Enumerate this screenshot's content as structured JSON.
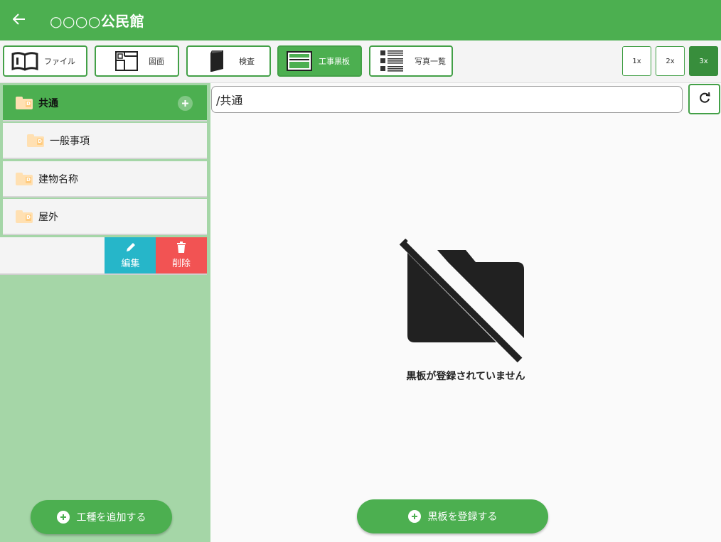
{
  "appbar": {
    "title": "○○○○公民館",
    "back_icon": "arrow-left-icon"
  },
  "toolbar": {
    "buttons": [
      {
        "label": "ファイル",
        "icon": "open-book-icon",
        "active": false
      },
      {
        "label": "図面",
        "icon": "floor-plan-icon",
        "active": false
      },
      {
        "label": "検査",
        "icon": "binder-icon",
        "active": false
      },
      {
        "label": "工事黒板",
        "icon": "blackboard-icon",
        "active": true
      },
      {
        "label": "写真一覧",
        "icon": "list-icon",
        "active": false
      }
    ],
    "zoom": [
      {
        "label": "1x",
        "active": false
      },
      {
        "label": "2x",
        "active": false
      },
      {
        "label": "3x",
        "active": true
      }
    ]
  },
  "sidebar": {
    "items": [
      {
        "label": "共通",
        "selected": true,
        "level": 0
      },
      {
        "label": "一般事項",
        "selected": false,
        "level": 1
      },
      {
        "label": "建物名称",
        "selected": false,
        "level": 0
      },
      {
        "label": "屋外",
        "selected": false,
        "level": 0
      }
    ],
    "folder_mark": "D",
    "actions": {
      "edit": "編集",
      "delete": "削除"
    },
    "add_button": "工種を追加する"
  },
  "main": {
    "path": "/共通",
    "empty_message": "黒板が登録されていません",
    "register_button": "黒板を登録する"
  },
  "colors": {
    "primary": "#4caf50",
    "sidebar_bg": "#a5d6a7",
    "edit": "#26b6c9",
    "delete": "#f25353"
  }
}
